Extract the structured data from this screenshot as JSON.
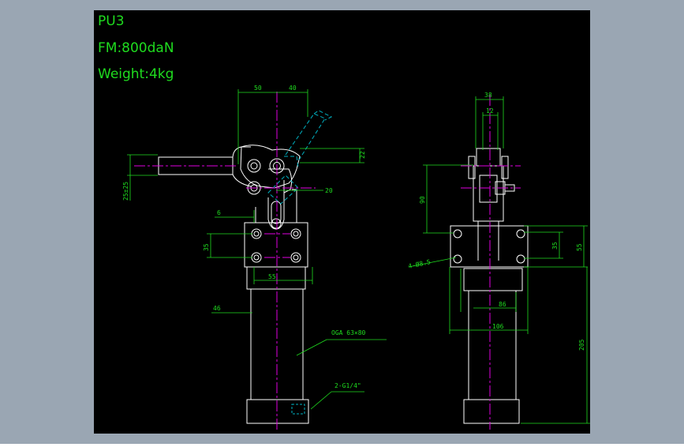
{
  "colors": {
    "frame_bg": "#9aa6b3",
    "canvas_bg": "#000000",
    "outline": "#ffffff",
    "dimension": "#1fdc1f",
    "centerline": "#e000e0",
    "hidden": "#00b0c0"
  },
  "title_block": {
    "model": "PU3",
    "force": "FM:800daN",
    "weight": "Weight:4kg"
  },
  "front_view": {
    "dims": {
      "top_left": "50",
      "top_right": "40",
      "right_22": "22",
      "right_20": "20",
      "left_stroke": "25±25",
      "left_6": "6",
      "left_35": "35",
      "mid_55": "55",
      "left_46": "46"
    },
    "callouts": {
      "cylinder": "OGA 63×80",
      "port": "2-G1/4\""
    }
  },
  "side_view": {
    "dims": {
      "top_38": "38",
      "top_12": "12",
      "left_90": "90",
      "holes": "4-Ø8.5",
      "right_35": "35",
      "right_55": "55",
      "bottom_86": "86",
      "bottom_106": "106",
      "total_205": "205"
    }
  }
}
